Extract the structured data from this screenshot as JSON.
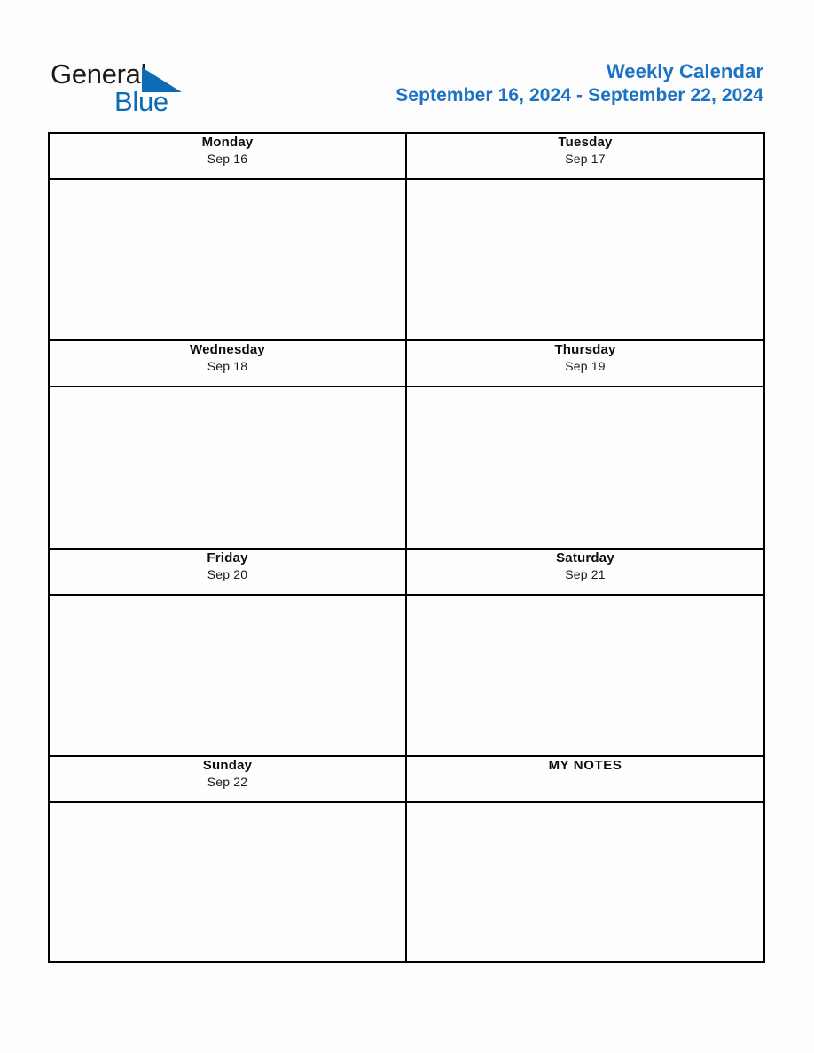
{
  "brand": {
    "name_part1": "General",
    "name_part2": "Blue",
    "logo_icon": "blue-triangle",
    "color_dark": "#1a1a1a",
    "color_blue": "#0b6cb5"
  },
  "header": {
    "title": "Weekly Calendar",
    "date_range": "September 16, 2024 - September 22, 2024",
    "title_color": "#1b72c4"
  },
  "theme": {
    "header_cell_bg": "#9bc0e4",
    "border_color": "#000000",
    "page_bg": "#fdfdfd",
    "cell_bg": "#fefefe"
  },
  "calendar": {
    "notes_label": "MY NOTES",
    "rows": [
      {
        "left": {
          "day": "Monday",
          "date": "Sep 16",
          "content": ""
        },
        "right": {
          "day": "Tuesday",
          "date": "Sep 17",
          "content": ""
        }
      },
      {
        "left": {
          "day": "Wednesday",
          "date": "Sep 18",
          "content": ""
        },
        "right": {
          "day": "Thursday",
          "date": "Sep 19",
          "content": ""
        }
      },
      {
        "left": {
          "day": "Friday",
          "date": "Sep 20",
          "content": ""
        },
        "right": {
          "day": "Saturday",
          "date": "Sep 21",
          "content": ""
        }
      },
      {
        "left": {
          "day": "Sunday",
          "date": "Sep 22",
          "content": ""
        },
        "right": {
          "day": "MY NOTES",
          "date": "",
          "content": ""
        }
      }
    ]
  }
}
